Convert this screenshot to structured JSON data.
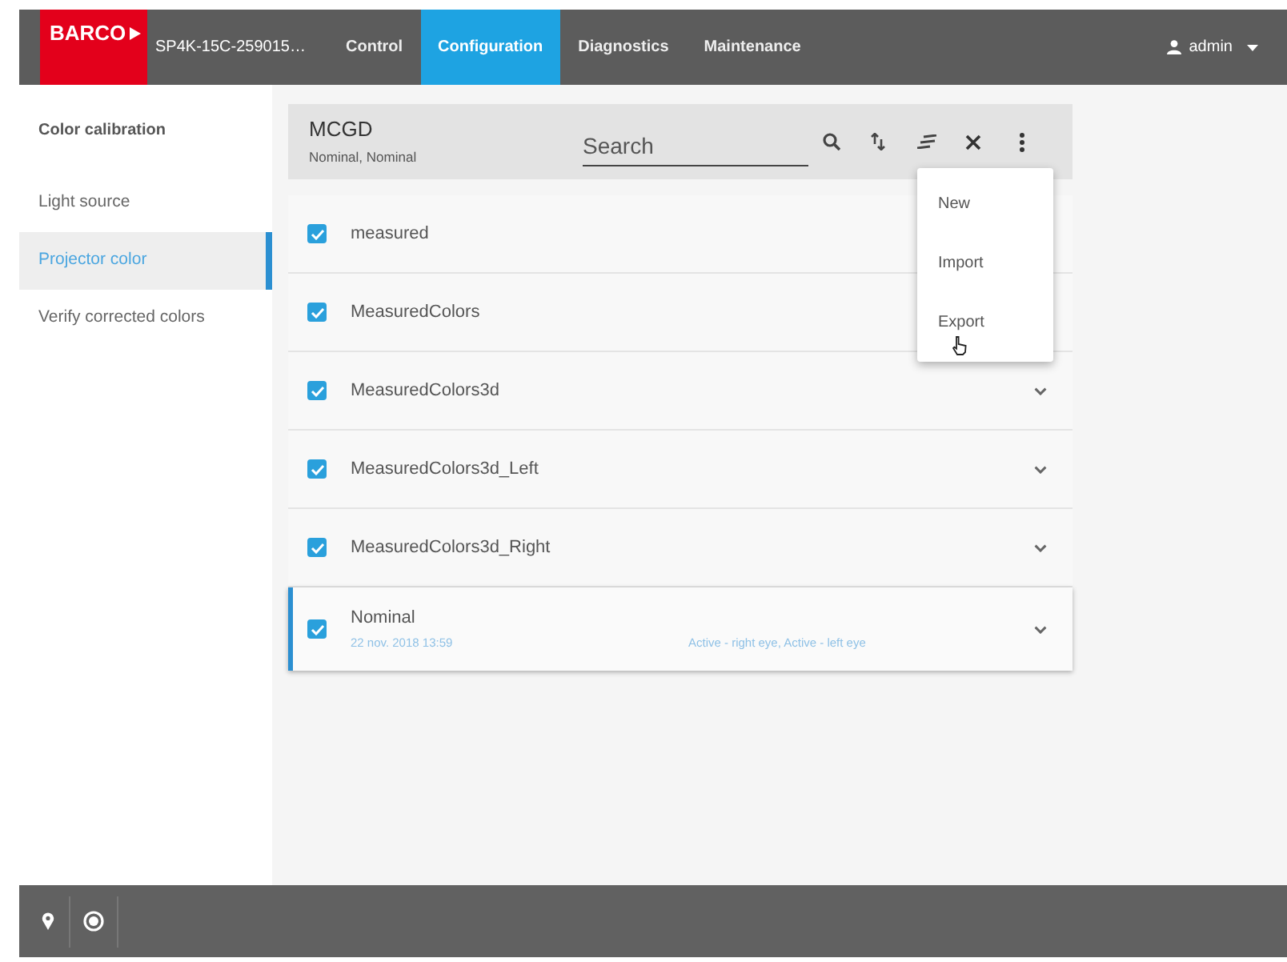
{
  "header": {
    "logo": "BARCO",
    "device_name": "SP4K-15C-259015…",
    "tabs": [
      {
        "label": "Control",
        "selected": false
      },
      {
        "label": "Configuration",
        "selected": true
      },
      {
        "label": "Diagnostics",
        "selected": false
      },
      {
        "label": "Maintenance",
        "selected": false
      }
    ],
    "user": "admin"
  },
  "sidebar": {
    "heading": "Color calibration",
    "items": [
      {
        "label": "Light source",
        "selected": false
      },
      {
        "label": "Projector color",
        "selected": true
      },
      {
        "label": "Verify corrected colors",
        "selected": false
      }
    ]
  },
  "panel": {
    "title": "MCGD",
    "subtitle": "Nominal, Nominal",
    "search": {
      "placeholder": "Search"
    },
    "rows": [
      {
        "name": "measured",
        "checked": true,
        "selected": false,
        "expand_icon": false
      },
      {
        "name": "MeasuredColors",
        "checked": true,
        "selected": false,
        "expand_icon": false
      },
      {
        "name": "MeasuredColors3d",
        "checked": true,
        "selected": false,
        "expand_icon": true
      },
      {
        "name": "MeasuredColors3d_Left",
        "checked": true,
        "selected": false,
        "expand_icon": true
      },
      {
        "name": "MeasuredColors3d_Right",
        "checked": true,
        "selected": false,
        "expand_icon": true
      },
      {
        "name": "Nominal",
        "checked": true,
        "selected": true,
        "expand_icon": true,
        "date": "22 nov. 2018 13:59",
        "status": "Active - right eye, Active - left eye"
      }
    ]
  },
  "menu": {
    "items": [
      "New",
      "Import",
      "Export"
    ]
  }
}
